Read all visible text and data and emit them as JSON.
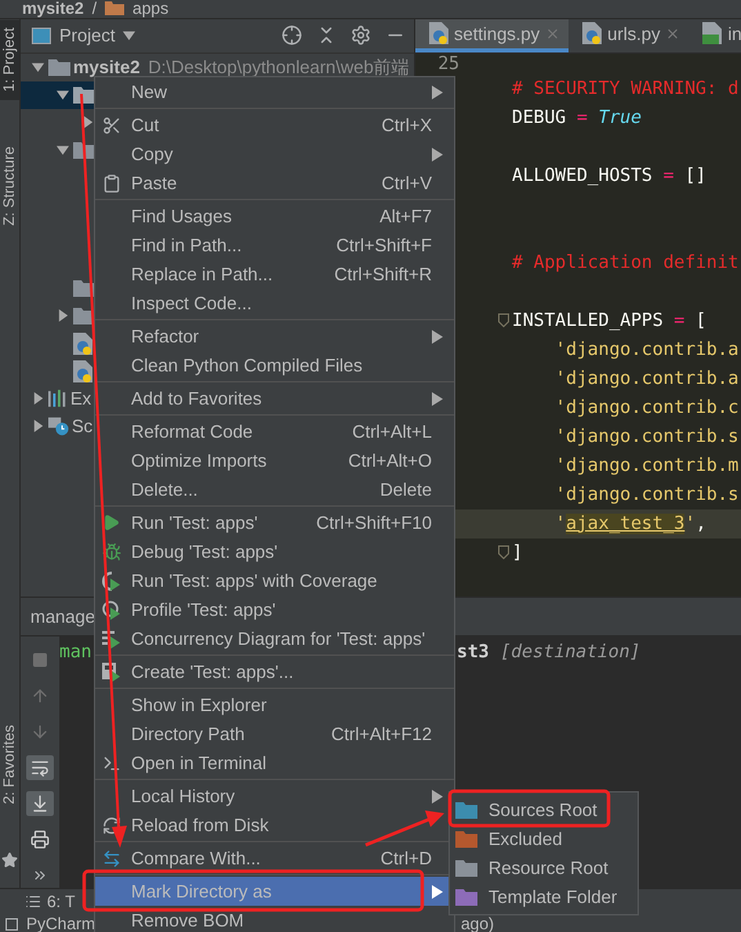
{
  "breadcrumb": {
    "separator": "/",
    "items": [
      {
        "label": "mysite2",
        "kind": "project"
      },
      {
        "label": "apps",
        "kind": "folder"
      }
    ]
  },
  "side_tabs_top": [
    {
      "label": "1: Project",
      "selected": true
    },
    {
      "label": "Z: Structure",
      "selected": false
    }
  ],
  "side_tabs_bottom": [
    {
      "label": "2: Favorites",
      "selected": false,
      "kind": "favorites"
    }
  ],
  "project": {
    "title": "Project",
    "tree": [
      {
        "kind": "project",
        "label": "mysite2",
        "path": "D:\\Desktop\\pythonlearn\\web前端",
        "expanded": true,
        "selected": false,
        "children": [
          {
            "kind": "folder",
            "expanded": true,
            "selected": true,
            "children": [
              {
                "kind": "folder",
                "expanded": false,
                "selected": false
              }
            ]
          },
          {
            "kind": "folder",
            "expanded": true,
            "selected": false,
            "children": [
              {
                "kind": "covered"
              },
              {
                "kind": "covered"
              },
              {
                "kind": "covered"
              },
              {
                "kind": "covered"
              }
            ]
          },
          {
            "kind": "folder",
            "selected": false
          },
          {
            "kind": "folder",
            "expanded": false,
            "selected": false
          },
          {
            "kind": "pyfile",
            "selected": false
          },
          {
            "kind": "pyfile",
            "selected": false
          }
        ]
      },
      {
        "kind": "library",
        "label": "Ex",
        "expanded": false,
        "selected": false
      },
      {
        "kind": "scratches",
        "label": "Sc",
        "expanded": false,
        "selected": false
      }
    ]
  },
  "editor": {
    "tabs": [
      {
        "label": "settings.py",
        "kind": "python",
        "selected": true,
        "closable": true
      },
      {
        "label": "urls.py",
        "kind": "python",
        "selected": false,
        "closable": true
      },
      {
        "label": "in",
        "kind": "html",
        "selected": false,
        "closable": false
      }
    ],
    "lines": [
      {
        "kind": "gutter",
        "number": "25"
      },
      {
        "kind": "code",
        "tokens": [
          {
            "text": "# SECURITY WARNING: d",
            "kind": "comment"
          }
        ]
      },
      {
        "kind": "code",
        "tokens": [
          {
            "text": "DEBUG ",
            "kind": "name"
          },
          {
            "text": "=",
            "kind": "op"
          },
          {
            "text": " True",
            "kind": "keyword"
          }
        ]
      },
      {
        "kind": "blank"
      },
      {
        "kind": "code",
        "tokens": [
          {
            "text": "ALLOWED_HOSTS ",
            "kind": "name"
          },
          {
            "text": "=",
            "kind": "op"
          },
          {
            "text": " []",
            "kind": "name"
          }
        ]
      },
      {
        "kind": "blank"
      },
      {
        "kind": "blank"
      },
      {
        "kind": "code",
        "tokens": [
          {
            "text": "# Application definit",
            "kind": "comment"
          }
        ]
      },
      {
        "kind": "blank"
      },
      {
        "kind": "code",
        "fold": true,
        "tokens": [
          {
            "text": "INSTALLED_APPS ",
            "kind": "name"
          },
          {
            "text": "=",
            "kind": "op"
          },
          {
            "text": " [",
            "kind": "name"
          }
        ]
      },
      {
        "kind": "code",
        "tokens": [
          {
            "text": "    'django.contrib.a",
            "kind": "string"
          }
        ]
      },
      {
        "kind": "code",
        "tokens": [
          {
            "text": "    'django.contrib.a",
            "kind": "string"
          }
        ]
      },
      {
        "kind": "code",
        "tokens": [
          {
            "text": "    'django.contrib.c",
            "kind": "string"
          }
        ]
      },
      {
        "kind": "code",
        "tokens": [
          {
            "text": "    'django.contrib.s",
            "kind": "string"
          }
        ]
      },
      {
        "kind": "code",
        "tokens": [
          {
            "text": "    'django.contrib.m",
            "kind": "string"
          }
        ]
      },
      {
        "kind": "code",
        "tokens": [
          {
            "text": "    'django.contrib.s",
            "kind": "string"
          }
        ]
      },
      {
        "kind": "code",
        "current": true,
        "tokens": [
          {
            "text": "    '",
            "kind": "string"
          },
          {
            "text": "ajax_test_3",
            "kind": "match"
          },
          {
            "text": "'",
            "kind": "string"
          },
          {
            "text": ",",
            "kind": "name"
          }
        ]
      },
      {
        "kind": "code",
        "fold": true,
        "tokens": [
          {
            "text": "]",
            "kind": "name"
          }
        ]
      }
    ]
  },
  "run": {
    "tab": "manage",
    "console": [
      {
        "text": "man",
        "kind": "command"
      },
      {
        "text": "st3",
        "kind": "output"
      },
      {
        "text": "[destination]",
        "kind": "hint"
      }
    ]
  },
  "tool_tabs": [
    {
      "label": "6: T"
    }
  ],
  "status_bar": {
    "left": "PyCharm",
    "right": "ago)"
  },
  "context_menu": [
    {
      "kind": "plain",
      "label": "New",
      "submenu": true,
      "selected": false
    },
    {
      "kind": "separator"
    },
    {
      "kind": "cut",
      "label": "Cut",
      "shortcut": "Ctrl+X",
      "selected": false
    },
    {
      "kind": "plain",
      "label": "Copy",
      "submenu": true,
      "selected": false
    },
    {
      "kind": "paste",
      "label": "Paste",
      "shortcut": "Ctrl+V",
      "selected": false
    },
    {
      "kind": "separator"
    },
    {
      "kind": "plain",
      "label": "Find Usages",
      "shortcut": "Alt+F7",
      "selected": false
    },
    {
      "kind": "plain",
      "label": "Find in Path...",
      "shortcut": "Ctrl+Shift+F",
      "selected": false
    },
    {
      "kind": "plain",
      "label": "Replace in Path...",
      "shortcut": "Ctrl+Shift+R",
      "selected": false
    },
    {
      "kind": "plain",
      "label": "Inspect Code...",
      "selected": false
    },
    {
      "kind": "separator"
    },
    {
      "kind": "plain",
      "label": "Refactor",
      "submenu": true,
      "selected": false
    },
    {
      "kind": "plain",
      "label": "Clean Python Compiled Files",
      "selected": false
    },
    {
      "kind": "separator"
    },
    {
      "kind": "plain",
      "label": "Add to Favorites",
      "submenu": true,
      "selected": false
    },
    {
      "kind": "separator"
    },
    {
      "kind": "plain",
      "label": "Reformat Code",
      "shortcut": "Ctrl+Alt+L",
      "selected": false
    },
    {
      "kind": "plain",
      "label": "Optimize Imports",
      "shortcut": "Ctrl+Alt+O",
      "selected": false
    },
    {
      "kind": "plain",
      "label": "Delete...",
      "shortcut": "Delete",
      "selected": false
    },
    {
      "kind": "separator"
    },
    {
      "kind": "run",
      "label": "Run 'Test: apps'",
      "shortcut": "Ctrl+Shift+F10",
      "selected": false
    },
    {
      "kind": "debug",
      "label": "Debug 'Test: apps'",
      "selected": false
    },
    {
      "kind": "coverage",
      "label": "Run 'Test: apps' with Coverage",
      "selected": false
    },
    {
      "kind": "profile",
      "label": "Profile 'Test: apps'",
      "selected": false
    },
    {
      "kind": "concurrency",
      "label": "Concurrency Diagram for 'Test: apps'",
      "selected": false
    },
    {
      "kind": "separator"
    },
    {
      "kind": "create",
      "label": "Create 'Test: apps'...",
      "selected": false
    },
    {
      "kind": "separator"
    },
    {
      "kind": "plain",
      "label": "Show in Explorer",
      "selected": false
    },
    {
      "kind": "plain",
      "label": "Directory Path",
      "shortcut": "Ctrl+Alt+F12",
      "selected": false
    },
    {
      "kind": "terminal",
      "label": "Open in Terminal",
      "selected": false
    },
    {
      "kind": "separator"
    },
    {
      "kind": "plain",
      "label": "Local History",
      "submenu": true,
      "selected": false
    },
    {
      "kind": "reload",
      "label": "Reload from Disk",
      "selected": false
    },
    {
      "kind": "separator"
    },
    {
      "kind": "compare",
      "label": "Compare With...",
      "shortcut": "Ctrl+D",
      "selected": false
    },
    {
      "kind": "separator"
    },
    {
      "kind": "plain",
      "label": "Mark Directory as",
      "submenu": true,
      "selected": true
    },
    {
      "kind": "plain",
      "label": "Remove BOM",
      "selected": false
    }
  ],
  "submenu": [
    {
      "kind": "sources",
      "label": "Sources Root"
    },
    {
      "kind": "excluded",
      "label": "Excluded"
    },
    {
      "kind": "resource",
      "label": "Resource Root"
    },
    {
      "kind": "template",
      "label": "Template Folder"
    }
  ]
}
